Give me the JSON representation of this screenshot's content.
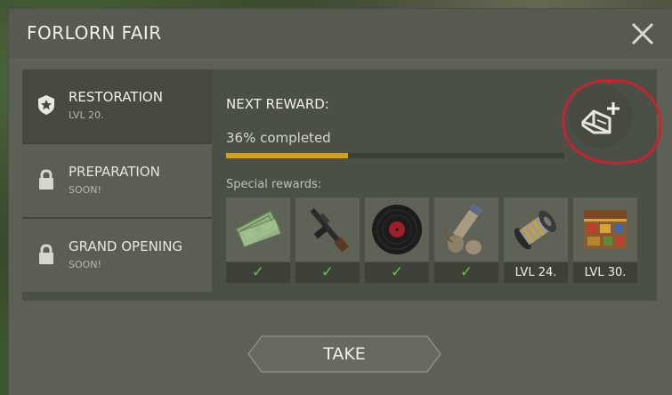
{
  "title": "FORLORN FAIR",
  "sidebar": {
    "items": [
      {
        "label": "RESTORATION",
        "sub": "LVL 20.",
        "icon": "medal-star-icon"
      },
      {
        "label": "PREPARATION",
        "sub": "SOON!",
        "icon": "lock-icon"
      },
      {
        "label": "GRAND OPENING",
        "sub": "SOON!",
        "icon": "lock-icon"
      }
    ]
  },
  "main": {
    "next_reward_label": "NEXT REWARD:",
    "progress_text": "36% completed",
    "progress_value": 0.36,
    "special_rewards_label": "Special rewards:",
    "rewards": [
      {
        "icon": "banknotes-icon",
        "status": "✓"
      },
      {
        "icon": "rifle-icon",
        "status": "✓"
      },
      {
        "icon": "vinyl-record-icon",
        "status": "✓"
      },
      {
        "icon": "telescope-parts-icon",
        "status": "✓"
      },
      {
        "icon": "spring-mechanism-icon",
        "status": "LVL 24."
      },
      {
        "icon": "treasure-chest-icon",
        "status": "LVL 30."
      }
    ]
  },
  "blueprint_button_icon": "blueprint-plus-icon",
  "take_label": "TAKE",
  "colors": {
    "accent_progress": "#d1a11b",
    "check_green": "#64c04a",
    "annotation_red": "#e0182a"
  }
}
